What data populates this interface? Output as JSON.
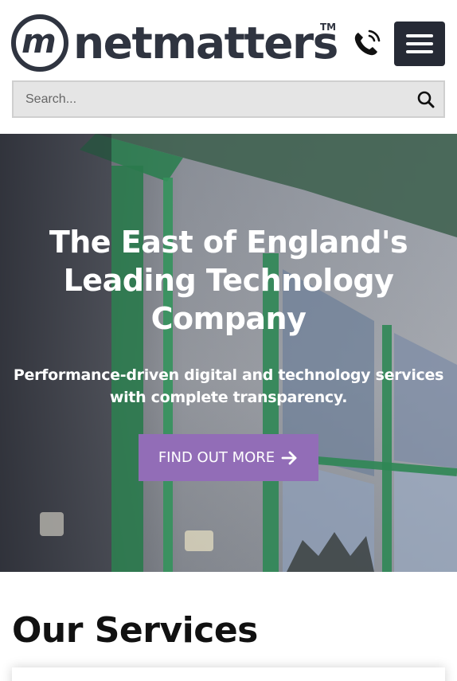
{
  "header": {
    "logo_text": "netmatters",
    "logo_mark": "m",
    "logo_tm": "TM",
    "phone_icon": "phone-icon",
    "menu_icon": "hamburger-menu-icon"
  },
  "search": {
    "placeholder": "Search...",
    "icon": "search-icon"
  },
  "hero": {
    "title": "The East of England's Leading Technology Company",
    "subtitle": "Performance-driven digital and technology services with complete transparency.",
    "cta_label": "FIND OUT MORE",
    "cta_icon": "arrow-right-icon"
  },
  "services": {
    "title": "Our Services"
  },
  "colors": {
    "brand_dark": "#2f3440",
    "menu_bg": "#262a35",
    "cta_bg": "#926db7",
    "search_bg": "#e5e5e5"
  }
}
